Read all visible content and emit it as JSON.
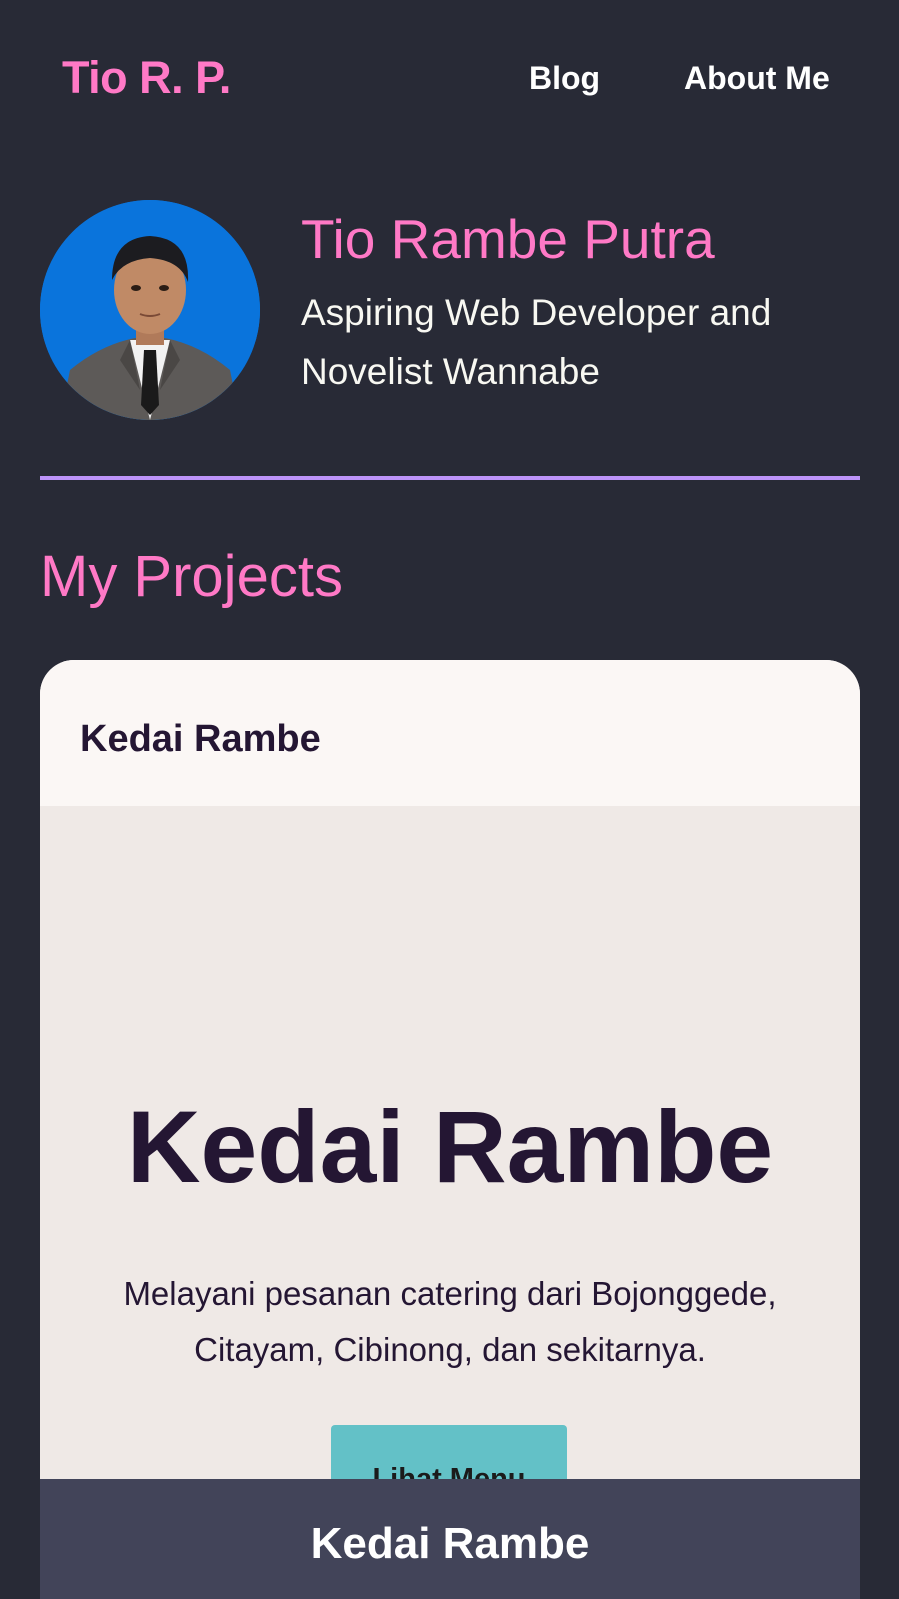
{
  "nav": {
    "brand": "Tio R. P.",
    "links": [
      {
        "label": "Blog"
      },
      {
        "label": "About Me"
      }
    ]
  },
  "profile": {
    "name": "Tio Rambe Putra",
    "tagline": "Aspiring Web Developer and Novelist Wannabe",
    "avatar_icon": "profile-photo"
  },
  "projects": {
    "heading": "My Projects",
    "items": [
      {
        "title": "Kedai Rambe",
        "preview": {
          "hero_title": "Kedai Rambe",
          "description": "Melayani pesanan catering dari Bojonggede, Citayam, Cibinong, dan sekitarnya.",
          "button_label": "Lihat Menu",
          "footer_title": "Kedai Rambe"
        }
      }
    ]
  },
  "colors": {
    "background": "#282a36",
    "accent_pink": "#ff79c6",
    "accent_purple": "#bd93f9",
    "button_teal": "#63c1c7",
    "footer_slate": "#424459",
    "dark_text": "#241633"
  }
}
